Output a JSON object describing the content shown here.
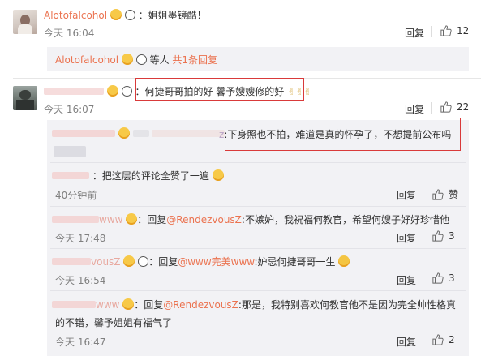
{
  "comment1": {
    "user": "Alotofalcohol",
    "text": "：姐姐墨镜酷！",
    "time": "今天 16:04",
    "reply_label": "回复",
    "likes": "12",
    "sub_summary": {
      "user": "Alotofalcohol",
      "suffix": " 等人 ",
      "replies": "共1条回复"
    }
  },
  "comment2": {
    "text": "：何捷哥哥拍的好 馨予嫂嫂修的好",
    "time": "今天 16:07",
    "reply_label": "回复",
    "likes": "22",
    "sub1": {
      "prefix": "：回复",
      "mention": "@RendezvousZ",
      "text": ":下身照也不拍，难道是真的怀孕了，不想提前公布吗"
    },
    "sub2": {
      "text": "：把这层的评论全赞了一遍",
      "time": "40分钟前",
      "reply_label": "回复",
      "like_label": "赞"
    },
    "sub3": {
      "user_tail": "www",
      "prefix": "：回复",
      "mention": "@RendezvousZ",
      "text": ":不嫉妒，我祝福何教官，希望何嫂子好好珍惜他",
      "time": "今天 17:48",
      "reply_label": "回复",
      "likes": "3"
    },
    "sub4": {
      "user_tail": "vousZ",
      "prefix": "：回复",
      "mention": "@www完美www",
      "text": ":妒忌何捷哥哥一生",
      "time": "今天 16:54",
      "reply_label": "回复",
      "likes": "3"
    },
    "sub5": {
      "user_tail": "www",
      "prefix": "：回复",
      "mention": "@RendezvousZ",
      "text": ":那是，我特别喜欢何教官他不是因为完全帅性格真",
      "text2": "的不错，馨予姐姐有福气了",
      "time": "今天 16:47",
      "reply_label": "回复",
      "likes": "2"
    }
  },
  "colors": {
    "link": "#eb7350",
    "highlight_box": "#d93a3a",
    "sub_bg": "#f2f2f5"
  }
}
